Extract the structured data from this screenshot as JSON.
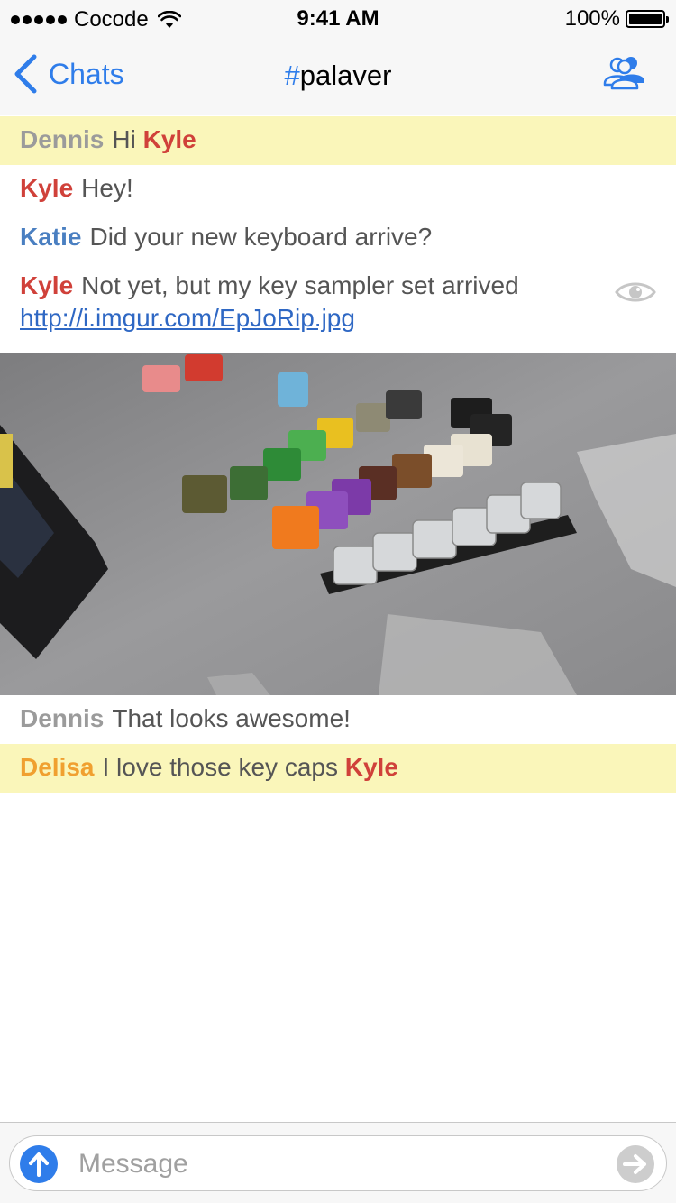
{
  "status_bar": {
    "carrier": "Cocode",
    "time": "9:41 AM",
    "battery_percent": "100%",
    "battery_level": 1.0
  },
  "nav": {
    "back_label": "Chats",
    "title_hash": "#",
    "title_name": "palaver",
    "members_icon": "group-icon"
  },
  "colors": {
    "accent": "#2f7dea",
    "highlight_bg": "#faf6ba",
    "nick_dennis": "#9b9b9b",
    "nick_kyle": "#d0413a",
    "nick_katie": "#4a7fc1",
    "nick_delisa": "#f0a030"
  },
  "messages": [
    {
      "nick": "Dennis",
      "text_before": "Hi ",
      "mention": "Kyle",
      "highlight": true
    },
    {
      "nick": "Kyle",
      "text": "Hey!"
    },
    {
      "nick": "Katie",
      "text": "Did your new keyboard arrive?"
    },
    {
      "nick": "Kyle",
      "text": "Not yet, but my key sampler set arrived",
      "link": "http://i.imgur.com/EpJoRip.jpg"
    },
    {
      "nick": "Dennis",
      "text": "That looks awesome!"
    },
    {
      "nick": "Delisa",
      "text_before": "I love those key caps ",
      "mention": "Kyle",
      "highlight": true
    }
  ],
  "image_preview": {
    "icon": "eye-icon",
    "description_hidden": true
  },
  "composer": {
    "placeholder": "Message",
    "upload_icon": "upload-arrow-icon",
    "send_icon": "send-arrow-icon"
  }
}
